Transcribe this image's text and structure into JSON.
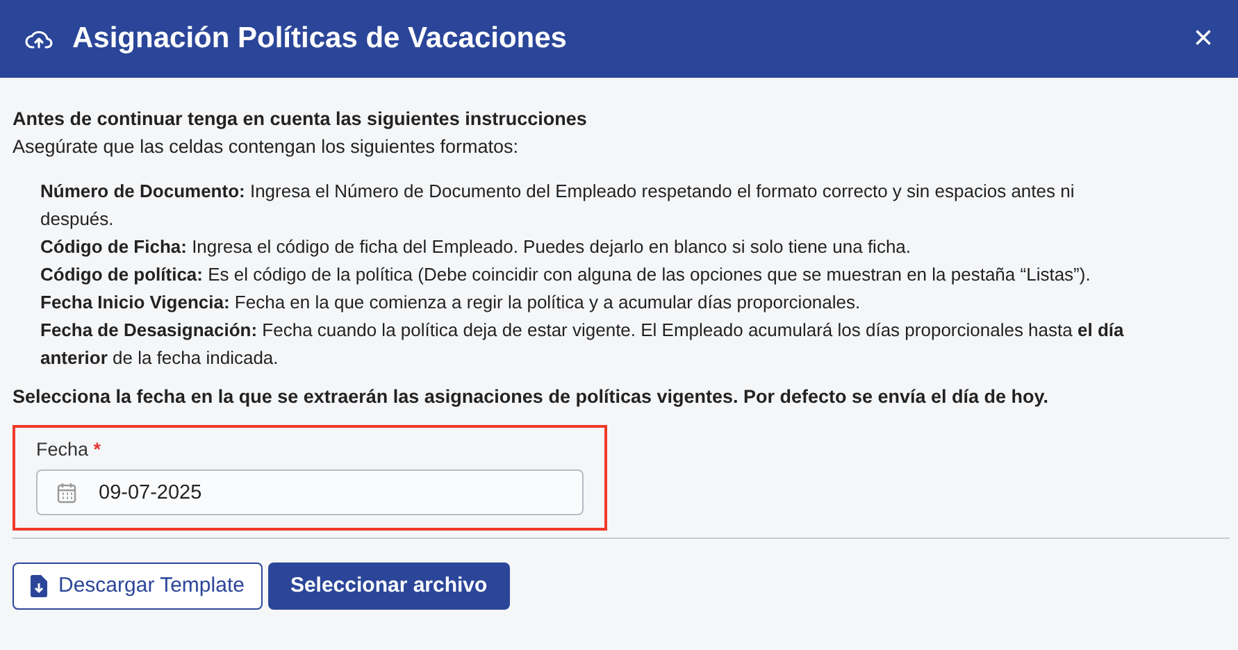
{
  "dialog": {
    "title": "Asignación Políticas de Vacaciones",
    "close": "×"
  },
  "intro": {
    "heading": "Antes de continuar tenga en cuenta las siguientes instrucciones",
    "subheading": "Asegúrate que las celdas contengan los siguientes formatos:"
  },
  "instructions": [
    "**Número de Documento:** Ingresa el Número de Documento del Empleado respetando el formato correcto y sin espacios antes ni después.",
    "**Código de Ficha:** Ingresa el código de ficha del Empleado. Puedes dejarlo en blanco si solo tiene una ficha.",
    "**Código de política:** Es el código de la política (Debe coincidir con alguna de las opciones que se muestran en la pestaña “Listas”).",
    "**Fecha Inicio Vigencia:** Fecha en la que comienza a regir la política y a acumular días proporcionales.",
    "**Fecha de Desasignación:** Fecha cuando la política deja de estar vigente. El Empleado acumulará los días proporcionales hasta **el día anterior** de la fecha indicada."
  ],
  "date_note": "Selecciona la fecha en la que se extraerán las asignaciones de políticas vigentes. Por defecto se envía el día de hoy.",
  "date_field": {
    "label": "Fecha",
    "required_mark": "*",
    "value": "09-07-2025",
    "highlighted": true
  },
  "buttons": [
    {
      "label": "Descargar Template",
      "kind": "outline"
    },
    {
      "label": "Seleccionar archivo",
      "kind": "primary"
    }
  ]
}
